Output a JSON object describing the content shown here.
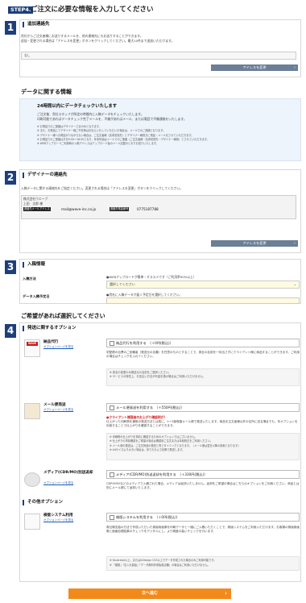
{
  "step": {
    "badge": "STEP4.",
    "title": "ご注文に必要な情報を入力してください"
  },
  "sections": {
    "contact": {
      "num": "1",
      "title": "追加連絡先",
      "desc1": "貴社からご注文者様にお送りするメールを、他の連絡先にもお送りすることができます。",
      "desc2": "追加・変更される場合は「アドレスを変更」ボタンをクリックしてください。最大10件まで追加いただけます。",
      "field_value": "なし",
      "button": "アドレスを変更"
    },
    "data_info": {
      "heading": "データに関する情報",
      "check_title": "24時間以内にデータチェックいたします",
      "check_line1": "ご注文後、貴社スタッフが所定の時間内に入稿データをチェックいたします。",
      "check_line2": "印刷可能であればデータチェック完了メールを、不備があればメール、または電話で不備連絡をいたします。",
      "notes": [
        "お電話でのご連絡はデザイナーさまのみとなります。",
        "また、お電話にてデザイナー様ご不在時はお伝えいたしていただいた場合は、メールでのご連絡となります。",
        "デザイナー様へお電話がつながらない場合は、ご注文者様（請求書宛先）とデザイナー様双方に電話・メールをさせていただきます。",
        "お電話でのご連絡は平日9:00〜18:00となり、年末年始はメールでのご連絡（ご注文者様・請求書宛先・デザイナー様宛）とさせていただきます。",
        "WEBアップロードご利用時の入稿アドレスはアップロード後のメール記載のとおりお送りいたします。"
      ]
    },
    "designer": {
      "num": "2",
      "title": "デザイナーの連絡先",
      "desc": "入稿データに関する連絡先をご指定ください。変更される場合は「アドレスを変更」ボタンをクリックしてください。",
      "company": "株式会社ウエーブ",
      "name": "上田　太郎 様",
      "email_label": "連絡先メールアドレス",
      "email": "mail@wave-inc.co.jp",
      "phone_label": "連絡先電話番号",
      "phone": "0775187788",
      "button": "アドレスを変更"
    },
    "submission": {
      "num": "3",
      "title": "入稿情報",
      "method_label": "入稿方法",
      "method_note": "●WEBアップロードが簡単・オススメです（ご利用率90%以上）",
      "method_select": "選択してください",
      "date_label": "データ入稿予定日",
      "date_note": "●貴社に入稿データが届く予定日を選択してください。"
    },
    "options_heading": "ご希望があれば選択してください",
    "shipping": {
      "num": "4",
      "title": "発送に関するオプション",
      "items": [
        {
          "name": "納品代行",
          "link": "オプションページを見る",
          "check_label": "納品代行を利用する　（＋0円(税込)）",
          "desc": "宅配便の伝票のご依頼者（発送元の名義）を任意のものとすることで、貴社の名前を一切出さずにクライアント様に納品することができます。ご利用の場合はチェックを入れてください。",
          "notes": [
            "宛名の変更のみ発送元の名前をご選択ください。",
            "サービスの特性上、お支払い方法が代金引換の場合はご利用いただけません。"
          ]
        },
        {
          "name": "メール便発送",
          "link": "オプションページを見る",
          "check_label": "メール便発送を利用する　（＋550円(税込)）",
          "red": "●クライアント様直納のお上がり確認例が！",
          "desc": "仕上がった印刷物を通常の発送方法とは別に、1〜3部程度メール便で発送いたします。商品を注文者様以外の住所に送る場合でも、本オプションを利用することで仕上がりを確認することができます。",
          "notes": [
            "印刷物の仕上がりを事前に確認するためのオプションではございません。",
            "仕上がりの事前確認をご希望の場合は確認用ご注文または本紙校正をご利用ください。",
            "メール便の発送は、ご注文商品の発送と同じタイミングとなります。（メール便は翌日以降の到着となります）",
            "A4サイズより大きい場合は、折りたたんで封筒で発送します。"
          ]
        },
        {
          "name": "メディア(CDR/MO)別送返却",
          "link": "オプションページを見る",
          "check_label": "メディア(CDR/MO)別送返却を利用する　（＋330円(税込)）",
          "desc": "CDRやMOなどのメディアで入稿された場合、メディアは返却いたしません。返却をご希望の場合はこちらのオプションをご利用ください。商品とは別にメール便にて返却いたします。"
        }
      ]
    },
    "other": {
      "title": "その他オプション",
      "items": [
        {
          "name": "検版システム利用",
          "link": "オプションページを見る",
          "check_label": "検版システムを利用する　（＋0円(税込)）",
          "desc": "貴社様支給の方法で作成いただいた検版用画像を印刷データと一緒にご入稿いただくことで、検版システムをご利用いただけます。お客様の検版用画像と面面処理結果のチェックをデジタルにし、より精度の高いチェックを行います。",
          "notes": [
            "Illustrator以上、またはInDesign CS3以上でデータ作成された場合のみご利用可能です。",
            "「複数」「名入れ製品」「データ無料作成後各店舗」の場合はご利用いただけません。"
          ]
        }
      ]
    }
  },
  "next_button": "次へ進む"
}
